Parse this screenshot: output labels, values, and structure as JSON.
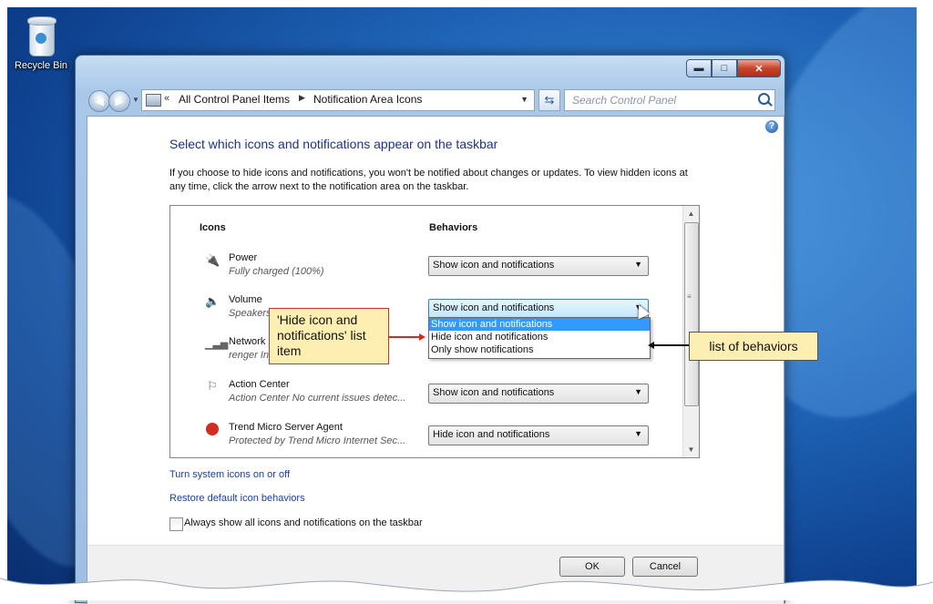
{
  "desktop": {
    "recycle_bin_label": "Recycle Bin"
  },
  "window": {
    "caption_buttons": {
      "minimize": "▬",
      "maximize": "□",
      "close": "✕"
    },
    "address": {
      "chevron": "«",
      "crumbs": [
        "All Control Panel Items",
        "Notification Area Icons"
      ],
      "separator": "▶"
    },
    "search_placeholder": "Search Control Panel",
    "help": "?",
    "title": "Select which icons and notifications appear on the taskbar",
    "description": "If you choose to hide icons and notifications, you won't be notified about changes or updates. To view hidden icons at any time, click the arrow next to the notification area on the taskbar.",
    "table": {
      "col_icons": "Icons",
      "col_behaviors": "Behaviors",
      "rows": [
        {
          "name": "Power",
          "subtitle": "Fully charged (100%)",
          "icon": "power-icon",
          "behavior": "Show icon and notifications"
        },
        {
          "name": "Volume",
          "subtitle": "Speakers",
          "icon": "volume-icon",
          "behavior": "Show icon and notifications"
        },
        {
          "name": "Network",
          "subtitle": "renger In",
          "icon": "network-icon",
          "behavior": ""
        },
        {
          "name": "Action Center",
          "subtitle": "Action Center  No current issues detec...",
          "icon": "flag-icon",
          "behavior": "Show icon and notifications"
        },
        {
          "name": "Trend Micro Server Agent",
          "subtitle": "Protected by Trend Micro Internet Sec...",
          "icon": "trend-micro-icon",
          "behavior": "Hide icon and notifications"
        }
      ],
      "dropdown_options": [
        "Show icon and notifications",
        "Hide icon and notifications",
        "Only show notifications"
      ],
      "dropdown_selected_index": 0
    },
    "links": {
      "system_icons": "Turn system icons on or off",
      "restore": "Restore default icon behaviors"
    },
    "checkbox_label": "Always show all icons and notifications on the taskbar",
    "checkbox_checked": false,
    "buttons": {
      "ok": "OK",
      "cancel": "Cancel"
    }
  },
  "callouts": {
    "hide_item": "'Hide icon and notifications' list item",
    "behaviors": "list of behaviors"
  }
}
